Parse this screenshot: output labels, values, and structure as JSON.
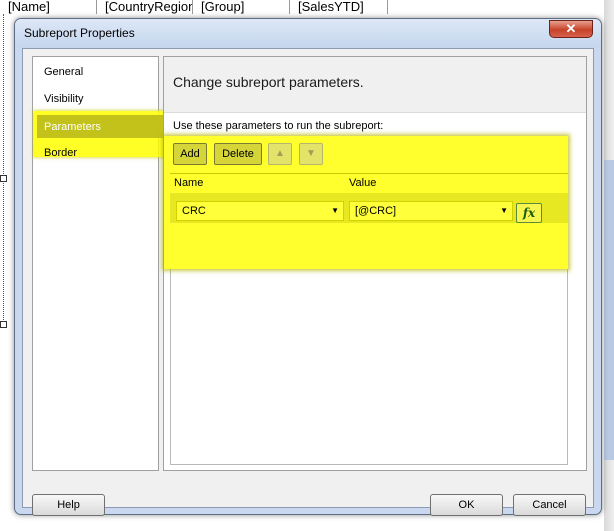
{
  "background": {
    "columns": [
      "[Name]",
      "[CountryRegionl",
      "[Group]",
      "[SalesYTD]"
    ]
  },
  "dialog": {
    "title": "Subreport Properties",
    "close_glyph": "✕"
  },
  "nav": {
    "items": [
      {
        "label": "General"
      },
      {
        "label": "Visibility"
      },
      {
        "label": "Parameters"
      },
      {
        "label": "Border"
      }
    ],
    "selected": "Parameters"
  },
  "content": {
    "heading": "Change subreport parameters.",
    "instruction": "Use these parameters to run the subreport:"
  },
  "toolbar": {
    "add_label": "Add",
    "delete_label": "Delete",
    "move_up_icon": "arrow-up-icon",
    "move_down_icon": "arrow-down-icon"
  },
  "grid": {
    "columns": [
      "Name",
      "Value"
    ],
    "rows": [
      {
        "name": "CRC",
        "value": "[@CRC]"
      }
    ],
    "expression_button_label": "fx"
  },
  "footer": {
    "help_label": "Help",
    "ok_label": "OK",
    "cancel_label": "Cancel"
  },
  "colors": {
    "highlight": "#ffff2e",
    "title_bar": "#c9d8ee",
    "close_button": "#c7432a"
  }
}
